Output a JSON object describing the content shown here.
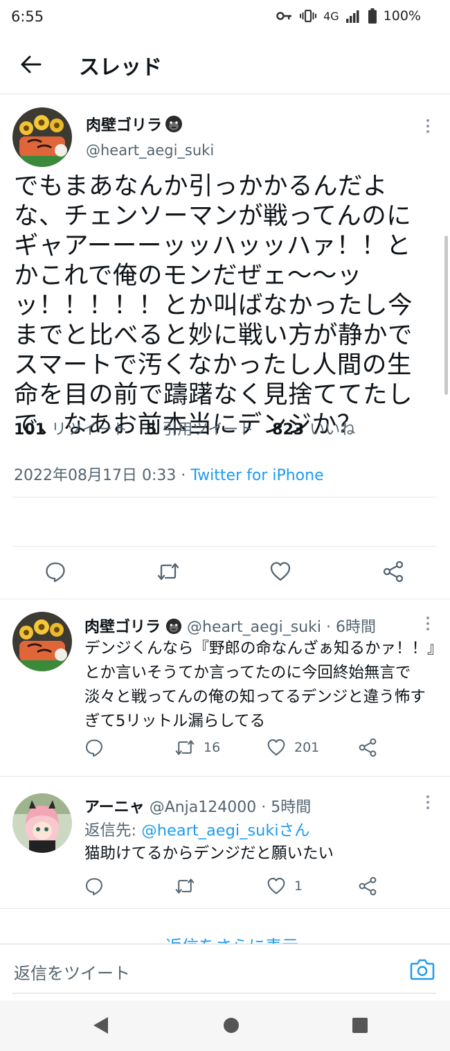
{
  "status_bar": {
    "time": "6:55",
    "network": "4G",
    "battery": "100%"
  },
  "header": {
    "title": "スレッド"
  },
  "main_tweet": {
    "display_name": "肉壁ゴリラ",
    "name_emoji": "gorilla-emoji",
    "handle": "@heart_aegi_suki",
    "text": "でもまあなんか引っかかるんだよな、チェンソーマンが戦ってんのにギャアーーーッッハッッハァ！！とかこれで俺のモンだぜェ〜〜ッッ！！！！！とか叫ばなかったし今までと比べると妙に戦い方が静かでスマートで汚くなかったし人間の生命を目の前で躊躇なく見捨ててたしで、なあお前本当にデンジか？",
    "timestamp": "2022年08月17日 0:33",
    "separator": "·",
    "source": "Twitter for iPhone",
    "stats": [
      {
        "count": "101",
        "label": "リツイート"
      },
      {
        "count": "5",
        "label": "引用ツイート"
      },
      {
        "count": "823",
        "label": "いいね"
      }
    ]
  },
  "replies": [
    {
      "display_name": "肉壁ゴリラ",
      "handle": "@heart_aegi_suki",
      "time": "· 6時間",
      "text": "デンジくんなら『野郎の命なんざぁ知るかァ！！』とか言いそうてか言ってたのに今回終始無言で淡々と戦ってんの俺の知ってるデンジと違う怖すぎて5リットル漏らしてる",
      "retweets": "16",
      "likes": "201"
    },
    {
      "display_name": "アーニャ",
      "handle": "@Anja124000",
      "time": "· 5時間",
      "reply_to_prefix": "返信先: ",
      "reply_to_handle": "@heart_aegi_sukiさん",
      "text": "猫助けてるからデンジだと願いたい",
      "retweets": "",
      "likes": "1"
    }
  ],
  "show_more": "返信をさらに表示",
  "compose": {
    "placeholder": "返信をツイート"
  },
  "colors": {
    "link": "#1d9bf0",
    "secondary_text": "#536471",
    "divider": "#e1e8ed"
  }
}
